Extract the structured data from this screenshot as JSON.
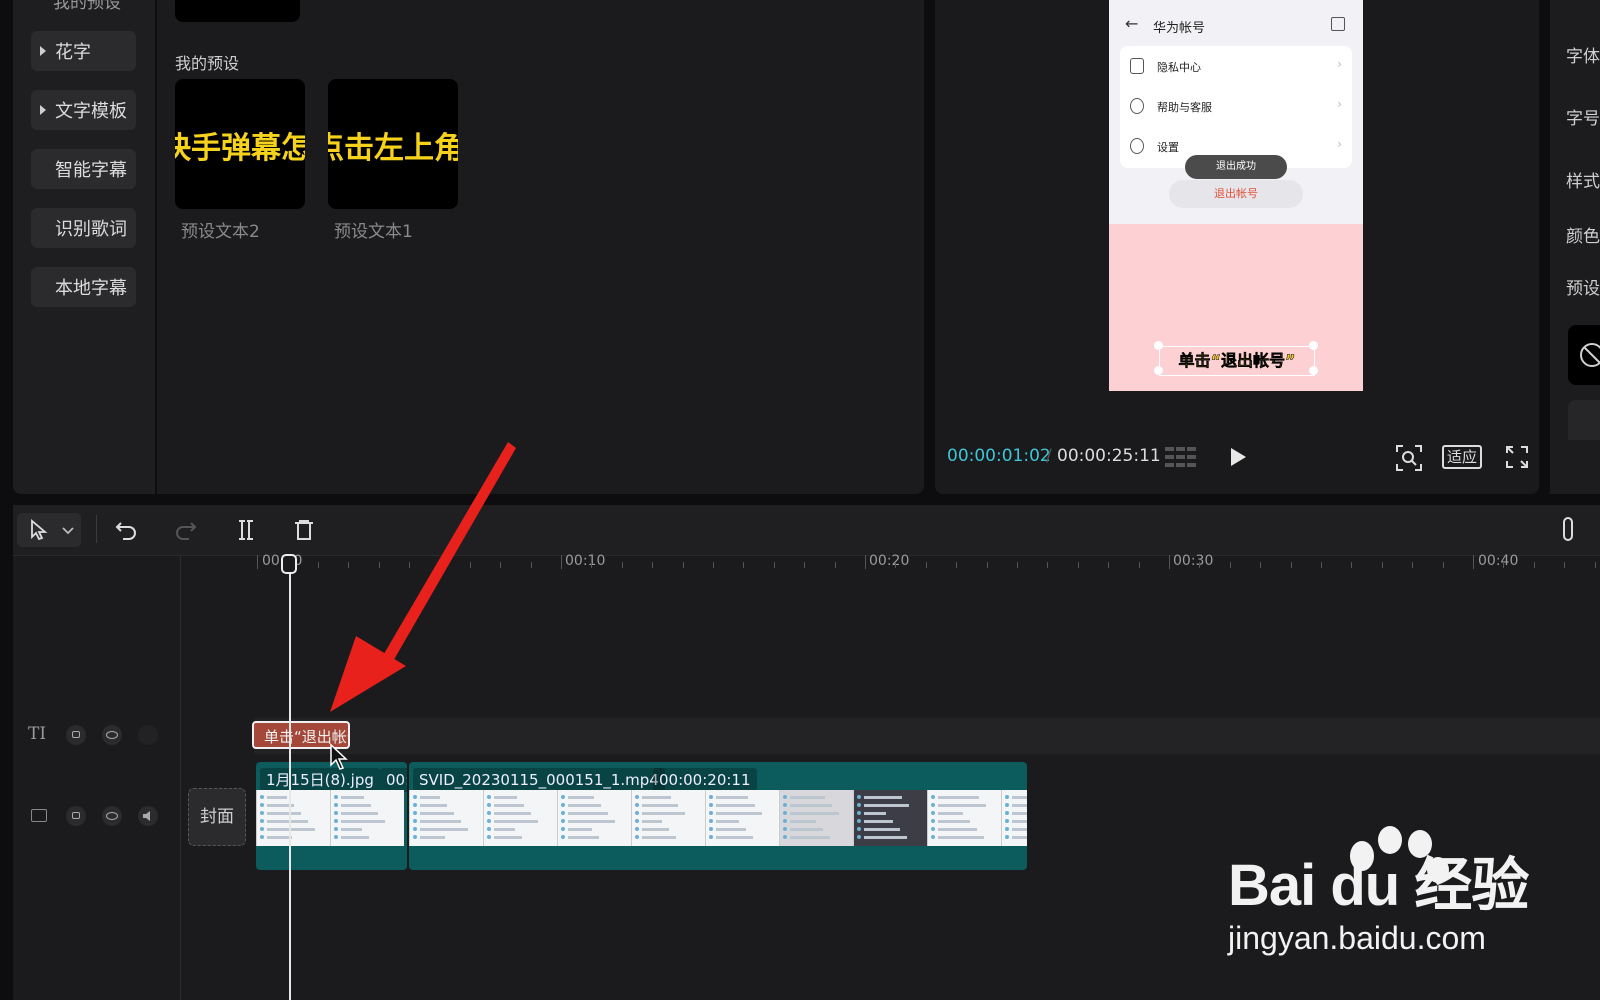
{
  "sidebar": {
    "top_partial": "我的预设",
    "items": [
      {
        "label": "花字",
        "expandable": true
      },
      {
        "label": "文字模板",
        "expandable": true
      },
      {
        "label": "智能字幕",
        "expandable": false
      },
      {
        "label": "识别歌词",
        "expandable": false
      },
      {
        "label": "本地字幕",
        "expandable": false
      }
    ]
  },
  "presets": {
    "section_title": "我的预设",
    "items": [
      {
        "preview_text": "快手弹幕怎么",
        "caption": "预设文本2"
      },
      {
        "preview_text": "点击左上角的",
        "caption": "预设文本1"
      }
    ]
  },
  "preview": {
    "phone": {
      "title": "华为帐号",
      "rows": [
        "隐私中心",
        "帮助与客服",
        "设置"
      ],
      "toast": "退出成功",
      "logout_button": "退出帐号",
      "subtitle": "单击“退出帐号”"
    },
    "current_time": "00:00:01:02",
    "separator": "/",
    "total_time": "00:00:25:11",
    "fit_label": "适应"
  },
  "right_panel": {
    "labels": [
      "字体",
      "字号",
      "样式",
      "颜色",
      "预设"
    ]
  },
  "timeline": {
    "ruler": [
      "00:00",
      "00:10",
      "00:20",
      "00:30",
      "00:40"
    ],
    "cover_label": "封面",
    "text_clip": "单击“退出帐号”",
    "image_clip": {
      "name": "1月15日(8).jpg",
      "duration": "00:"
    },
    "video_clip": {
      "name": "SVID_20230115_000151_1.mp4",
      "duration": "00:00:20:11"
    }
  },
  "watermark": {
    "logo": "Bai du 经验",
    "url": "jingyan.baidu.com"
  },
  "colors": {
    "accent": "#3ec5d6",
    "text_clip": "#a4493a",
    "video_clip": "#0c5b5d",
    "annotation_arrow": "#e8211d",
    "subtitle_yellow": "#f5d023"
  }
}
